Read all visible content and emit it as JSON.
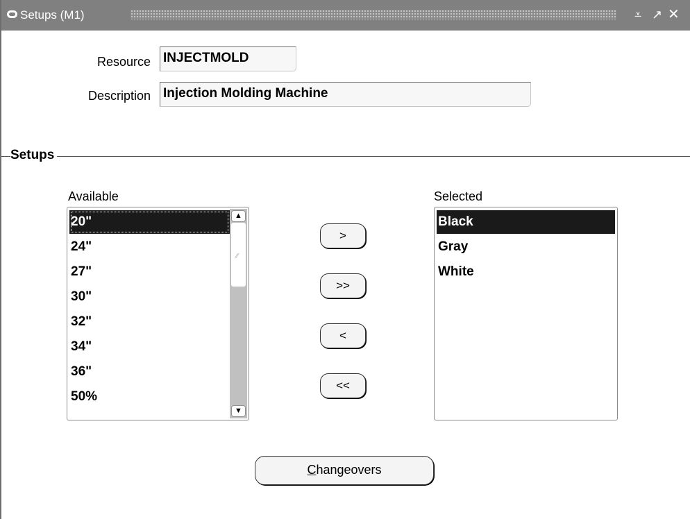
{
  "window": {
    "title": "Setups (M1)",
    "minimize_glyph": "⩡",
    "maximize_glyph": "↗",
    "close_glyph": "✕"
  },
  "form": {
    "resource_label": "Resource",
    "resource_value": "INJECTMOLD",
    "description_label": "Description",
    "description_value": "Injection Molding Machine"
  },
  "section": {
    "title": "Setups"
  },
  "available": {
    "label": "Available",
    "items": [
      "20\"",
      "24\"",
      "27\"",
      "30\"",
      "32\"",
      "34\"",
      "36\"",
      "50%"
    ],
    "selected_index": 0
  },
  "selected": {
    "label": "Selected",
    "items": [
      "Black",
      "Gray",
      "White"
    ],
    "selected_index": 0
  },
  "shuttle": {
    "move_one": ">",
    "move_all": ">>",
    "remove_one": "<",
    "remove_all": "<<"
  },
  "actions": {
    "changeovers_mnemonic": "C",
    "changeovers_rest": "hangeovers"
  },
  "colors": {
    "titlebar": "#808080",
    "selection": "#1a1a1a",
    "field_background": "#f7f7f7"
  }
}
